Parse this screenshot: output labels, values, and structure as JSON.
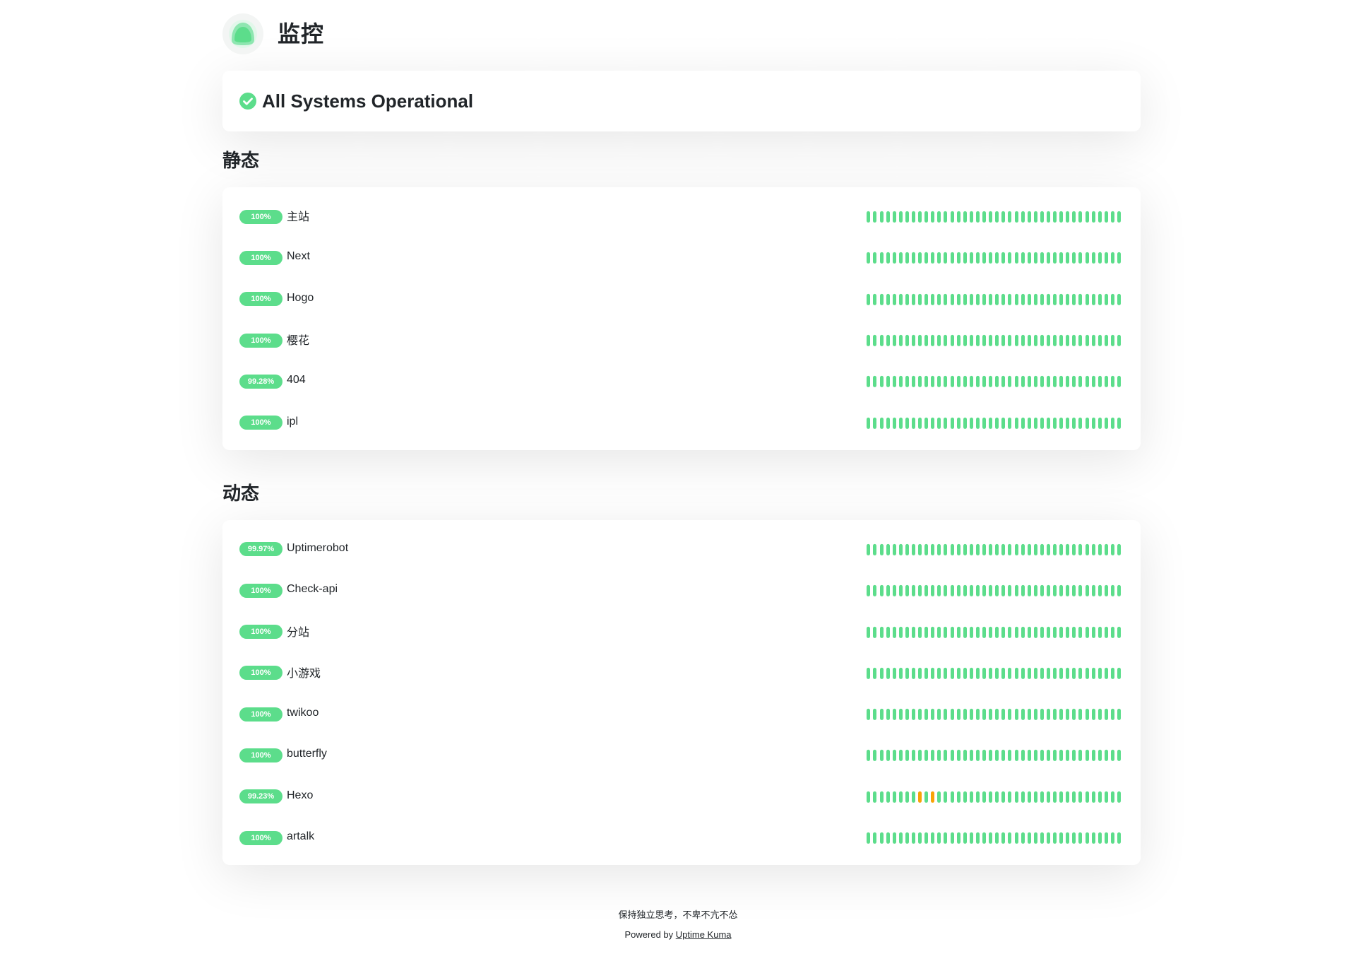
{
  "site": {
    "title": "监控"
  },
  "overall": {
    "status_text": "All Systems Operational",
    "status_icon": "check-circle-icon",
    "accent_color": "#5cdd8b"
  },
  "colors": {
    "up": "#5cdd8b",
    "warning": "#f8a306"
  },
  "groups": [
    {
      "title": "静态",
      "monitors": [
        {
          "uptime": "100%",
          "name": "主站",
          "beats": "all-up"
        },
        {
          "uptime": "100%",
          "name": "Next",
          "beats": "all-up"
        },
        {
          "uptime": "100%",
          "name": "Hogo",
          "beats": "all-up"
        },
        {
          "uptime": "100%",
          "name": "樱花",
          "beats": "all-up"
        },
        {
          "uptime": "99.28%",
          "name": "404",
          "beats": "all-up"
        },
        {
          "uptime": "100%",
          "name": "ipl",
          "beats": "all-up"
        }
      ]
    },
    {
      "title": "动态",
      "monitors": [
        {
          "uptime": "99.97%",
          "name": "Uptimerobot",
          "beats": "all-up"
        },
        {
          "uptime": "100%",
          "name": "Check-api",
          "beats": "all-up"
        },
        {
          "uptime": "100%",
          "name": "分站",
          "beats": "all-up"
        },
        {
          "uptime": "100%",
          "name": "小游戏",
          "beats": "all-up"
        },
        {
          "uptime": "100%",
          "name": "twikoo",
          "beats": "all-up"
        },
        {
          "uptime": "100%",
          "name": "butterfly",
          "beats": "all-up"
        },
        {
          "uptime": "99.23%",
          "name": "Hexo",
          "beats": "warn-8-10"
        },
        {
          "uptime": "100%",
          "name": "artalk",
          "beats": "all-up"
        }
      ]
    }
  ],
  "footer": {
    "motto": "保持独立思考，不卑不亢不怂",
    "powered_prefix": "Powered by ",
    "powered_link": "Uptime Kuma"
  }
}
